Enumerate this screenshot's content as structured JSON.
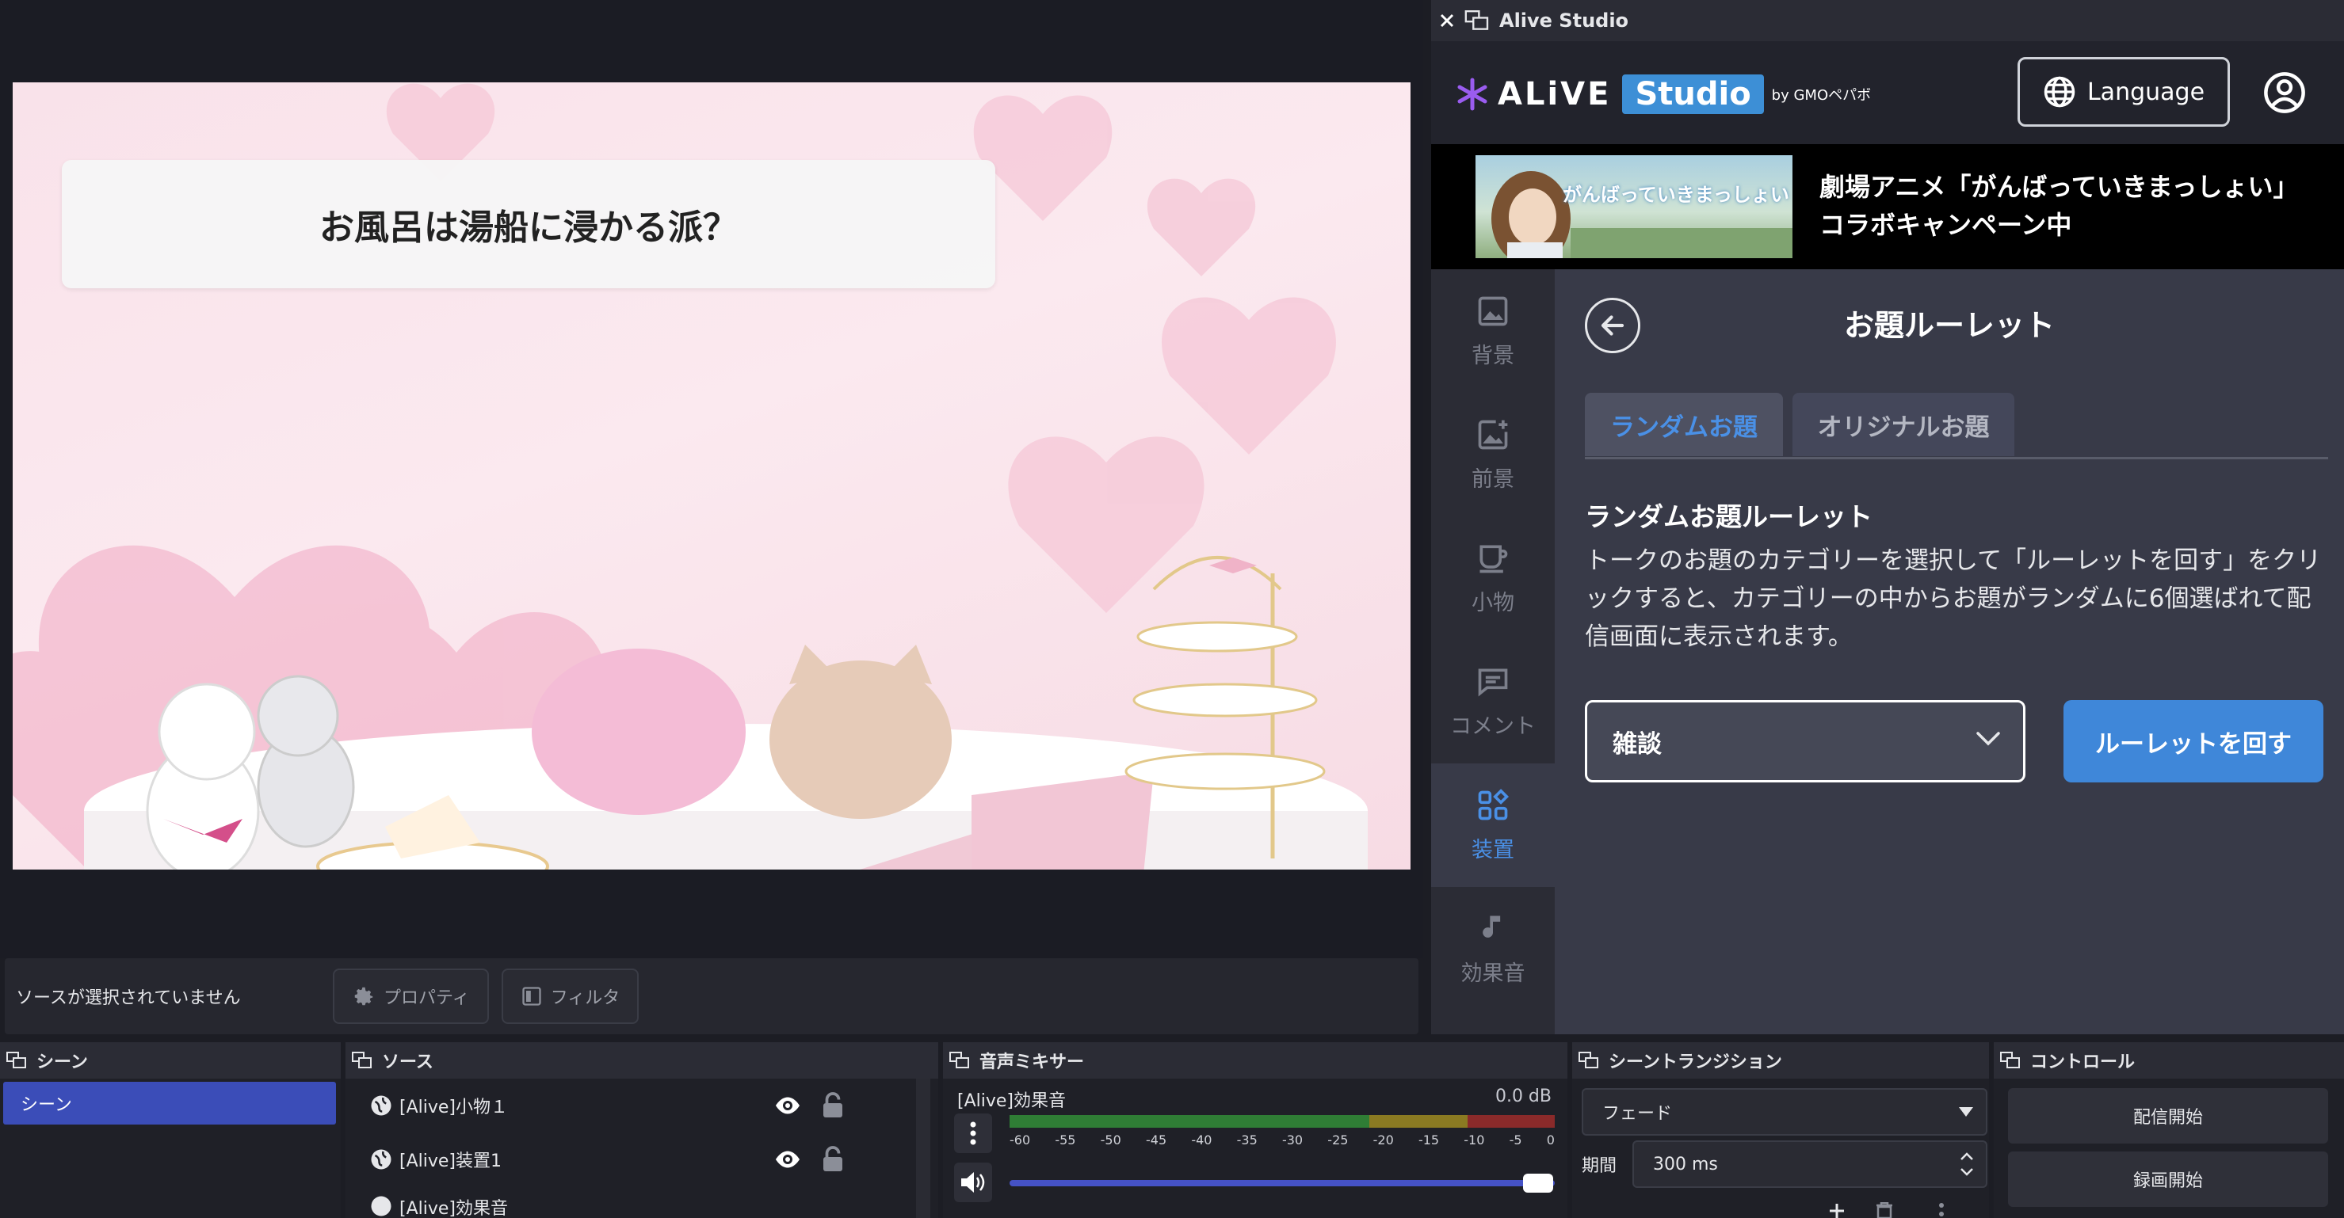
{
  "preview": {
    "question": "お風呂は湯船に浸かる派？"
  },
  "source_bar": {
    "no_source": "ソースが選択されていません",
    "properties_label": "プロパティ",
    "filters_label": "フィルタ"
  },
  "docks": {
    "scenes": {
      "title": "シーン",
      "items": [
        "シーン"
      ]
    },
    "sources": {
      "title": "ソース",
      "items": [
        "[Alive]小物１",
        "[Alive]装置1",
        "[Alive]効果音"
      ]
    },
    "mixer": {
      "title": "音声ミキサー",
      "track_name": "[Alive]効果音",
      "level": "0.0 dB",
      "ticks": [
        "-60",
        "-55",
        "-50",
        "-45",
        "-40",
        "-35",
        "-30",
        "-25",
        "-20",
        "-15",
        "-10",
        "-5",
        "0"
      ],
      "volume_fraction": 0.97
    },
    "transitions": {
      "title": "シーントランジション",
      "type": "フェード",
      "duration_label": "期間",
      "duration_value": "300 ms"
    },
    "controls": {
      "title": "コントロール",
      "start_stream": "配信開始",
      "start_record": "録画開始"
    }
  },
  "alive": {
    "window_title": "Alive Studio",
    "logo_alive": "ALiVE",
    "logo_studio": "Studio",
    "logo_by": "by GMOペパボ",
    "language_label": "Language",
    "banner": {
      "thumb_text": "がんばっていきまっしょい",
      "line1": "劇場アニメ「がんばっていきまっしょい」",
      "line2": "コラボキャンペーン中"
    },
    "nav": [
      {
        "label": "背景",
        "icon": "image-icon"
      },
      {
        "label": "前景",
        "icon": "image-plus-icon"
      },
      {
        "label": "小物",
        "icon": "cup-icon"
      },
      {
        "label": "コメント",
        "icon": "comment-icon"
      },
      {
        "label": "装置",
        "icon": "widgets-icon"
      },
      {
        "label": "効果音",
        "icon": "music-note-icon"
      }
    ],
    "page_title": "お題ルーレット",
    "tabs": {
      "random": "ランダムお題",
      "original": "オリジナルお題"
    },
    "section_title": "ランダムお題ルーレット",
    "section_desc": "トークのお題のカテゴリーを選択して「ルーレットを回す」をクリックすると、カテゴリーの中からお題がランダムに6個選ばれて配信画面に表示されます。",
    "category_value": "雑談",
    "spin_label": "ルーレットを回す"
  },
  "colors": {
    "accent_blue": "#3f87d9",
    "active_nav": "#4a90e6",
    "scene_selected": "#3b4db8"
  }
}
